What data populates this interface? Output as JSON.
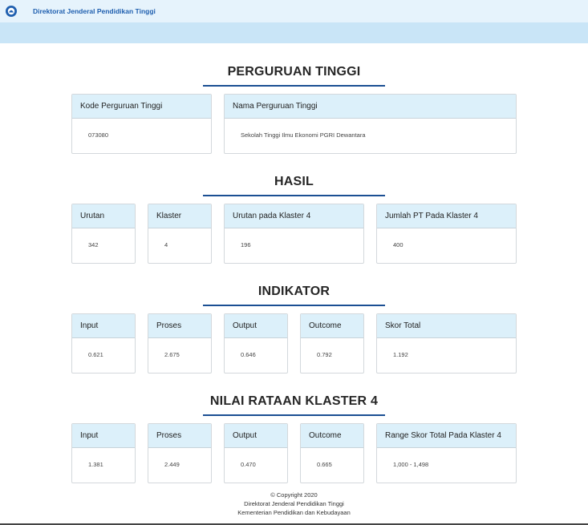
{
  "header": {
    "brand": "Direktorat Jenderal Pendidikan Tinggi"
  },
  "sections": {
    "pt": {
      "title": "PERGURUAN TINGGI",
      "cards": [
        {
          "label": "Kode Perguruan Tinggi",
          "value": "073080"
        },
        {
          "label": "Nama Perguruan Tinggi",
          "value": "Sekolah Tinggi Ilmu Ekonomi PGRI Dewantara"
        }
      ]
    },
    "hasil": {
      "title": "HASIL",
      "cards": [
        {
          "label": "Urutan",
          "value": "342"
        },
        {
          "label": "Klaster",
          "value": "4"
        },
        {
          "label": "Urutan pada Klaster 4",
          "value": "196"
        },
        {
          "label": "Jumlah PT Pada Klaster 4",
          "value": "400"
        }
      ]
    },
    "indikator": {
      "title": "INDIKATOR",
      "cards": [
        {
          "label": "Input",
          "value": "0.621"
        },
        {
          "label": "Proses",
          "value": "2.675"
        },
        {
          "label": "Output",
          "value": "0.646"
        },
        {
          "label": "Outcome",
          "value": "0.792"
        },
        {
          "label": "Skor Total",
          "value": "1.192"
        }
      ]
    },
    "rataan": {
      "title": "NILAI RATAAN KLASTER 4",
      "cards": [
        {
          "label": "Input",
          "value": "1.381"
        },
        {
          "label": "Proses",
          "value": "2.449"
        },
        {
          "label": "Output",
          "value": "0.470"
        },
        {
          "label": "Outcome",
          "value": "0.665"
        },
        {
          "label": "Range Skor Total Pada Klaster 4",
          "value": "1,000 - 1,498"
        }
      ]
    }
  },
  "footer": {
    "copyright": "© Copyright 2020",
    "org": "Direktorat Jenderal Pendidikan Tinggi",
    "ministry": "Kementerian Pendidikan dan Kebudayaan"
  },
  "colors": {
    "accent": "#1b4f93",
    "card_header": "#dcf0fa",
    "topbar": "#e6f3fc",
    "subbar": "#c9e5f7"
  }
}
